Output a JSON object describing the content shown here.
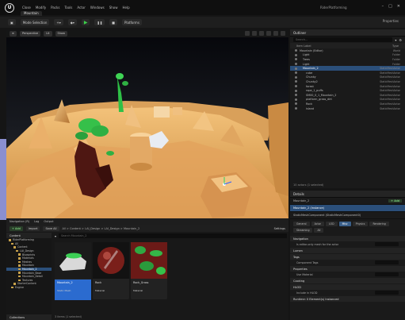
{
  "app": {
    "project_tab": "Mountain",
    "project_name": "RiderPlatforming",
    "menus": [
      "Close",
      "Modify",
      "Packs",
      "Tools",
      "Actor",
      "Windows",
      "Show",
      "Help"
    ]
  },
  "toolbar": {
    "mode": "Mode Selection",
    "platforms": "Platforms",
    "right_label": "Properties"
  },
  "viewport": {
    "perspective": "Perspective",
    "lit": "Lit",
    "show": "Show"
  },
  "outliner": {
    "title": "Outliner",
    "search_placeholder": "Search...",
    "col_label": "Item Label",
    "col_type": "Type",
    "rows": [
      {
        "label": "Mountain (Editor)",
        "type": "World",
        "indent": 0,
        "sel": false
      },
      {
        "label": "Light",
        "type": "Folder",
        "indent": 1,
        "sel": false
      },
      {
        "label": "Trees",
        "type": "Folder",
        "indent": 1,
        "sel": false
      },
      {
        "label": "Light",
        "type": "Folder",
        "indent": 1,
        "sel": false
      },
      {
        "label": "Mountain_2",
        "type": "StaticMeshActor",
        "indent": 1,
        "sel": true
      },
      {
        "label": "cube",
        "type": "StaticMeshActor",
        "indent": 2,
        "sel": false
      },
      {
        "label": "Chunky",
        "type": "StaticMeshActor",
        "indent": 2,
        "sel": false
      },
      {
        "label": "Chunky2",
        "type": "StaticMeshActor",
        "indent": 2,
        "sel": false
      },
      {
        "label": "forest",
        "type": "StaticMeshActor",
        "indent": 2,
        "sel": false
      },
      {
        "label": "rope_1_puffs",
        "type": "StaticMeshActor",
        "indent": 2,
        "sel": false
      },
      {
        "label": "SM00_0_1_Mountain_2",
        "type": "StaticMeshActor",
        "indent": 2,
        "sel": false
      },
      {
        "label": "platform_grass_dirt",
        "type": "StaticMeshActor",
        "indent": 2,
        "sel": false
      },
      {
        "label": "Rock",
        "type": "StaticMeshActor",
        "indent": 2,
        "sel": false
      },
      {
        "label": "island",
        "type": "StaticMeshActor",
        "indent": 2,
        "sel": false
      }
    ],
    "footer": "10 actors (1 selected)"
  },
  "details": {
    "title": "Details",
    "actor": "Mountain_2",
    "add_button": "+ Add",
    "component": "Mountain_2 (Instance)",
    "component_sub": "StaticMeshComponent (StaticMeshComponent0)",
    "filters": [
      "General",
      "Actor",
      "LOD",
      "Misc",
      "Physics",
      "Rendering",
      "Streaming",
      "All"
    ],
    "active_filter": "Misc",
    "sections": [
      {
        "name": "Navigation",
        "props": [
          "Is editor-only mesh for the actor"
        ]
      },
      {
        "name": "Lumen",
        "props": []
      },
      {
        "name": "Tags",
        "props": [
          "Component Tags"
        ]
      },
      {
        "name": "Properties",
        "props": [
          "Use Material"
        ]
      },
      {
        "name": "Cooking",
        "props": []
      },
      {
        "name": "HLOD",
        "props": [
          "Include in HLOD"
        ]
      },
      {
        "name": "Runtime: 0 Element(s) Instanced",
        "props": []
      }
    ]
  },
  "bottom": {
    "tabs": [
      "Navigation (R)",
      "Log",
      "Output"
    ],
    "content_title": "Content Browser",
    "add_label": "+ Add",
    "import_label": "Import",
    "save_label": "Save All",
    "breadcrumb": "All > Content > LAI_Design > LAI_Design > Mountain_2",
    "settings_label": "Settings",
    "search_placeholder": "Search Mountain_2",
    "tree_title": "Content",
    "tree_rows": [
      {
        "label": "RiderPlatforming",
        "indent": 0,
        "sel": false
      },
      {
        "label": "All",
        "indent": 1,
        "sel": false
      },
      {
        "label": "Content",
        "indent": 2,
        "sel": false
      },
      {
        "label": "LAI_Design",
        "indent": 3,
        "sel": false
      },
      {
        "label": "Blueprints",
        "indent": 4,
        "sel": false
      },
      {
        "label": "Materials",
        "indent": 4,
        "sel": false
      },
      {
        "label": "Meshes",
        "indent": 4,
        "sel": false
      },
      {
        "label": "Mountain",
        "indent": 4,
        "sel": false
      },
      {
        "label": "Mountain_2",
        "indent": 4,
        "sel": true
      },
      {
        "label": "Mountain_Base",
        "indent": 4,
        "sel": false
      },
      {
        "label": "Mountain_Detail",
        "indent": 4,
        "sel": false
      },
      {
        "label": "Textures",
        "indent": 4,
        "sel": false
      },
      {
        "label": "StarterContent",
        "indent": 2,
        "sel": false
      },
      {
        "label": "Engine",
        "indent": 1,
        "sel": false
      }
    ],
    "collections": "Collections",
    "assets": [
      {
        "name": "Mountain_2",
        "kind": "Static Mesh",
        "sel": true
      },
      {
        "name": "Rock",
        "kind": "Material",
        "sel": false
      },
      {
        "name": "Rock_Grass",
        "kind": "Material",
        "sel": false
      }
    ],
    "footer": "3 items (1 selected)"
  }
}
